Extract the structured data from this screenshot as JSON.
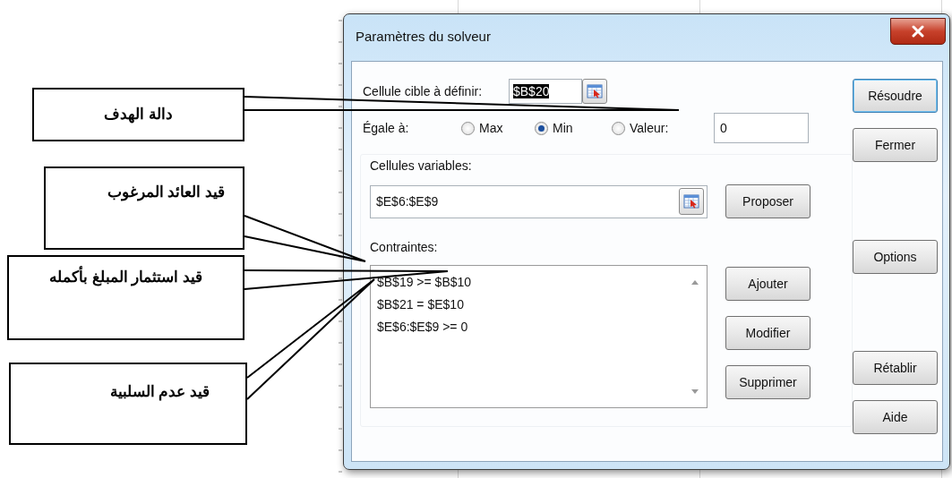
{
  "dialog": {
    "title": "Paramètres du solveur",
    "target_cell": {
      "label": "Cellule cible à définir:",
      "value": "$B$20",
      "value_selected": true
    },
    "equal_to": {
      "label": "Égale à:",
      "options": [
        {
          "label": "Max",
          "selected": false
        },
        {
          "label": "Min",
          "selected": true
        },
        {
          "label": "Valeur:",
          "selected": false
        }
      ],
      "value": "0"
    },
    "variable_cells": {
      "label": "Cellules variables:",
      "value": "$E$6:$E$9",
      "button": "Proposer"
    },
    "constraints": {
      "label": "Contraintes:",
      "items": [
        "$B$19 >= $B$10",
        "$B$21 = $E$10",
        "$E$6:$E$9 >= 0"
      ],
      "buttons": [
        "Ajouter",
        "Modifier",
        "Supprimer"
      ]
    },
    "side_buttons": [
      [
        {
          "label": "Résoudre",
          "default": true
        },
        {
          "label": "Fermer",
          "default": false
        }
      ],
      [
        {
          "label": "Options",
          "default": false
        }
      ],
      [
        {
          "label": "Rétablir",
          "default": false
        },
        {
          "label": "Aide",
          "default": false
        }
      ]
    ]
  },
  "annotations": [
    {
      "text": "دالة الهدف"
    },
    {
      "text": "قيد العائد المرغوب"
    },
    {
      "text": "قيد استثمار المبلغ بأكمله"
    },
    {
      "text": "قيد عدم السلبية"
    }
  ]
}
